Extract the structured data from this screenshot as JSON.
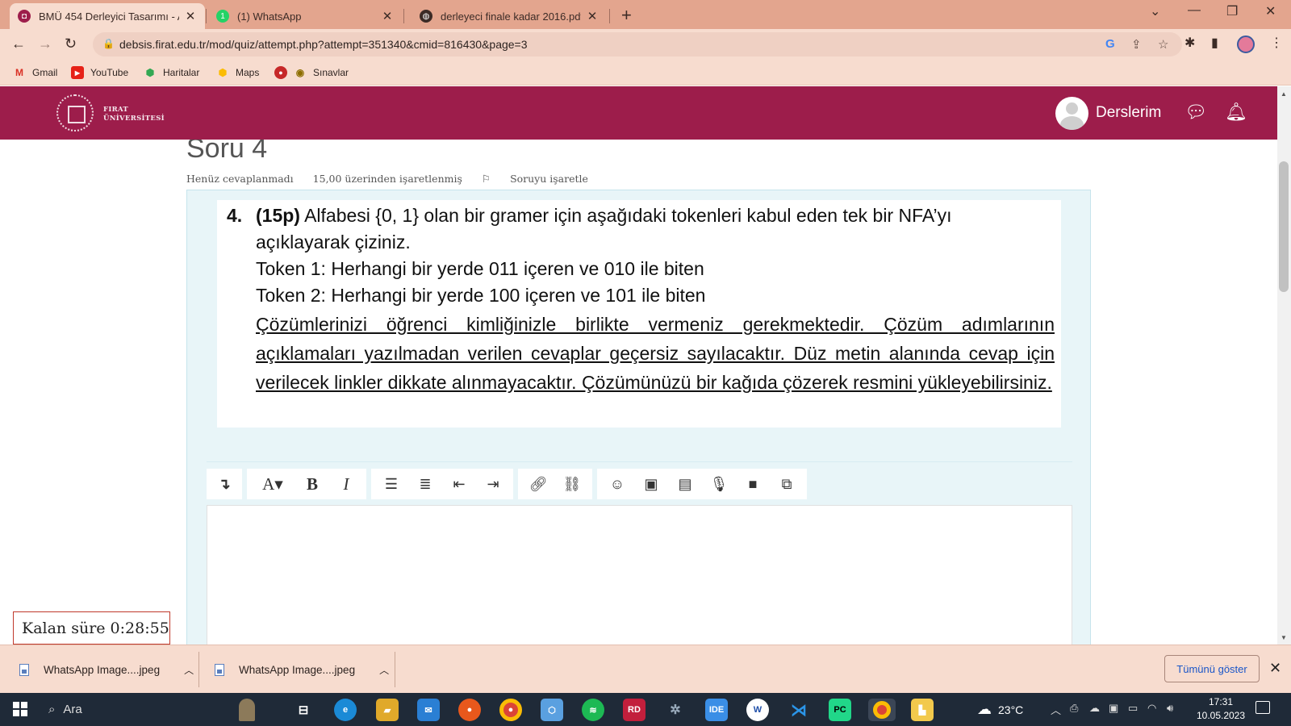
{
  "browser": {
    "tabs": [
      {
        "title": "BMÜ 454 Derleyici Tasarımı - AR/",
        "close": "✕",
        "active": true
      },
      {
        "title": "(1) WhatsApp",
        "close": "✕",
        "active": false
      },
      {
        "title": "derleyeci finale kadar 2016.pdf",
        "close": "✕",
        "active": false
      }
    ],
    "new_tab": "+",
    "address": "debsis.firat.edu.tr/mod/quiz/attempt.php?attempt=351340&cmid=816430&page=3",
    "bookmarks": [
      {
        "label": "Gmail",
        "icon": "gmail-icon"
      },
      {
        "label": "YouTube",
        "icon": "youtube-icon"
      },
      {
        "label": "Haritalar",
        "icon": "maps-pin-icon"
      },
      {
        "label": "Maps",
        "icon": "maps-pin-icon"
      },
      {
        "label": "Sınavlar",
        "icon": "sinavlar-icon"
      }
    ]
  },
  "site": {
    "logo_line1": "FIRAT",
    "logo_line2": "ÜNİVERSİTESİ",
    "nav_label": "Derslerim",
    "brand_color": "#9d1d4b"
  },
  "question": {
    "title": "Soru 4",
    "status": "Henüz cevaplanmadı",
    "marks": "15,00 üzerinden işaretlenmiş",
    "flag_label": "Soruyu işaretle",
    "number": "4.",
    "points": "(15p)",
    "line1": " Alfabesi {0, 1} olan bir gramer için aşağıdaki tokenleri kabul eden tek bir NFA’yı",
    "line2": "açıklayarak çiziniz.",
    "token1": "Token 1: Herhangi bir yerde 011 içeren ve 010 ile biten",
    "token2": "Token 2: Herhangi bir yerde 100 içeren ve 101 ile biten",
    "instructions": "Çözümlerinizi öğrenci kimliğinizle birlikte vermeniz gerekmektedir. Çözüm adımlarının açıklamaları yazılmadan verilen cevaplar geçersiz sayılacaktır. Düz metin alanında cevap için verilecek linkler dikkate alınmayacaktır. Çözümünüzü bir kağıda çözerek resmini yükleyebilirsiniz."
  },
  "editor_toolbar": {
    "expand": "↴",
    "font": "A▾",
    "bold": "B",
    "italic": "I"
  },
  "timer": "Kalan süre 0:28:55",
  "downloads": {
    "items": [
      "WhatsApp Image....jpeg",
      "WhatsApp Image....jpeg"
    ],
    "show_all": "Tümünü göster"
  },
  "taskbar": {
    "search": "Ara",
    "weather": "23°C",
    "time": "17:31",
    "date": "10.05.2023",
    "ide_label": "IDE",
    "pc_label": "PC",
    "rd_label": "RD"
  }
}
